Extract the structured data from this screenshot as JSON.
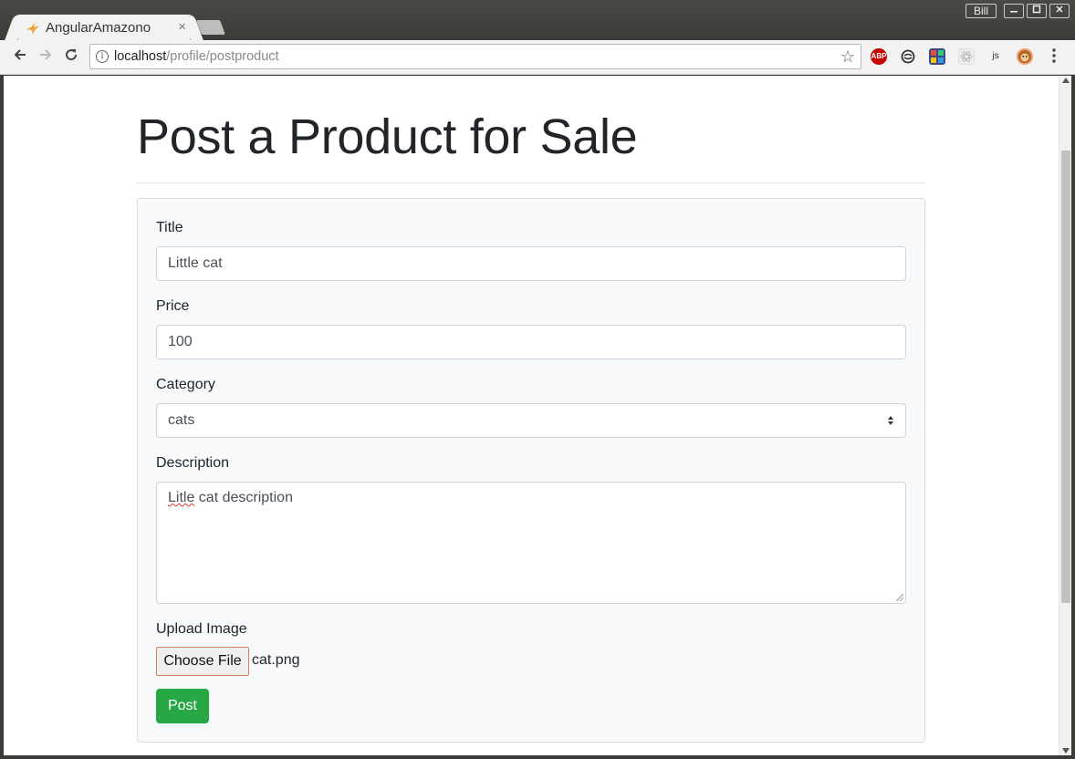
{
  "browser": {
    "tab_title": "AngularAmazono",
    "tab_close": "×",
    "user_name": "Bill",
    "url_host": "localhost",
    "url_path": "/profile/postproduct",
    "extensions": [
      "ABP",
      "",
      "",
      "",
      "js",
      ""
    ]
  },
  "page": {
    "title": "Post a Product for Sale"
  },
  "form": {
    "title_label": "Title",
    "title_value": "Little cat",
    "price_label": "Price",
    "price_value": "100",
    "category_label": "Category",
    "category_value": "cats",
    "description_label": "Description",
    "description_value_misspelled": "Litle",
    "description_value_rest": " cat description",
    "upload_label": "Upload Image",
    "choose_file_label": "Choose File",
    "file_name": "cat.png",
    "post_label": "Post"
  },
  "colors": {
    "accent": "#28a745"
  }
}
